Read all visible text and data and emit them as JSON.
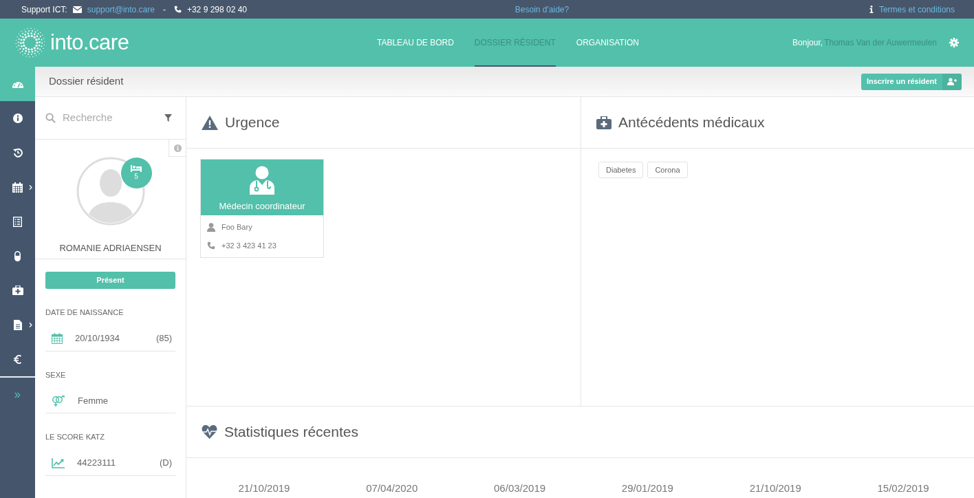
{
  "top_bar": {
    "support_label": "Support ICT:",
    "email": "support@into.care",
    "separator": "-",
    "phone": "+32 9 298 02 40",
    "help_link": "Besoin d'aide?",
    "terms_link": "Termes et conditions"
  },
  "header": {
    "logo_text": "into.care",
    "nav": [
      {
        "label": "TABLEAU DE BORD",
        "selected": false
      },
      {
        "label": "DOSSIER RÉSIDENT",
        "selected": true
      },
      {
        "label": "ORGANISATION",
        "selected": false
      }
    ],
    "greeting": "Bonjour,",
    "user_name": "Thomas Van der Auwermeulen"
  },
  "rail": [
    {
      "selected": true,
      "submenu": false
    },
    {
      "selected": false,
      "submenu": false
    },
    {
      "selected": false,
      "submenu": false
    },
    {
      "selected": false,
      "submenu": true
    },
    {
      "selected": false,
      "submenu": false
    },
    {
      "selected": false,
      "submenu": false
    },
    {
      "selected": false,
      "submenu": false
    },
    {
      "selected": false,
      "submenu": true
    },
    {
      "selected": false,
      "submenu": false
    }
  ],
  "page_title": "Dossier résident",
  "register_button": "Inscrire un résident",
  "search": {
    "placeholder": "Recherche"
  },
  "resident": {
    "room": "5",
    "name": "ROMANIE ADRIAENSEN",
    "status": "Présent",
    "fields": [
      {
        "label": "DATE DE NAISSANCE",
        "value": "20/10/1934",
        "extra": "(85)"
      },
      {
        "label": "SEXE",
        "value": "Femme"
      },
      {
        "label": "LE SCORE KATZ",
        "value": "44223111",
        "extra": "(D)"
      }
    ]
  },
  "urgency": {
    "title": "Urgence",
    "contacts": [
      {
        "role": "Médecin coordinateur",
        "name": "Foo Bary",
        "phone": "+32 3 423 41 23"
      }
    ]
  },
  "history": {
    "title": "Antécédents médicaux",
    "tags": [
      "Diabetes",
      "Corona"
    ]
  },
  "stats": {
    "title": "Statistiques récentes",
    "dates": [
      "21/10/2019",
      "07/04/2020",
      "06/03/2019",
      "29/01/2019",
      "21/10/2019",
      "15/02/2019"
    ]
  }
}
